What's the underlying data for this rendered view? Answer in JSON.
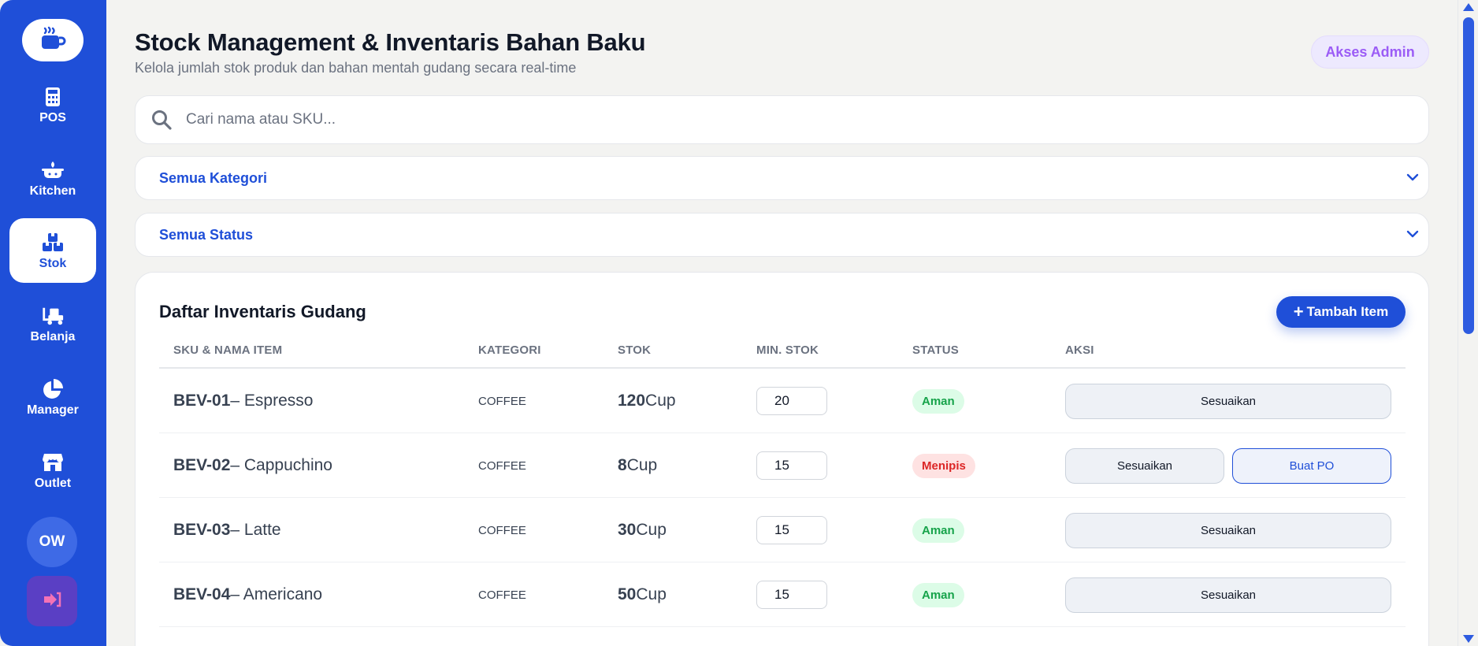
{
  "header": {
    "title": "Stock Management & Inventaris Bahan Baku",
    "subtitle": "Kelola jumlah stok produk dan bahan mentah gudang secara real-time",
    "admin_badge": "Akses Admin"
  },
  "sidebar": {
    "items": [
      {
        "label": "POS",
        "icon": "calculator-icon"
      },
      {
        "label": "Kitchen",
        "icon": "cooking-pot-icon"
      },
      {
        "label": "Stok",
        "icon": "boxes-icon"
      },
      {
        "label": "Belanja",
        "icon": "truck-icon"
      },
      {
        "label": "Manager",
        "icon": "pie-chart-icon"
      },
      {
        "label": "Outlet",
        "icon": "store-icon"
      }
    ],
    "active": "Stok",
    "avatar_initials": "OW",
    "logo_icon": "coffee-cup-icon",
    "logout_icon": "logout-icon"
  },
  "search": {
    "placeholder": "Cari nama atau SKU..."
  },
  "filters": {
    "category": "Semua Kategori",
    "status": "Semua Status"
  },
  "inventory": {
    "title": "Daftar Inventaris Gudang",
    "add_button": "Tambah Item",
    "columns": [
      "SKU & NAMA ITEM",
      "KATEGORI",
      "STOK",
      "MIN. STOK",
      "STATUS",
      "AKSI"
    ],
    "rows": [
      {
        "sku": "BEV-01",
        "name": " – Espresso",
        "category": "COFFEE",
        "stock": "120",
        "unit": " Cup",
        "min_stock": "20",
        "status": "Aman",
        "adjust": "Sesuaikan"
      },
      {
        "sku": "BEV-02",
        "name": " – Cappuchino",
        "category": "COFFEE",
        "stock": "8",
        "unit": " Cup",
        "min_stock": "15",
        "status": "Menipis",
        "adjust": "Sesuaikan",
        "po": "Buat PO"
      },
      {
        "sku": "BEV-03",
        "name": " – Latte",
        "category": "COFFEE",
        "stock": "30",
        "unit": " Cup",
        "min_stock": "15",
        "status": "Aman",
        "adjust": "Sesuaikan"
      },
      {
        "sku": "BEV-04",
        "name": " – Americano",
        "category": "COFFEE",
        "stock": "50",
        "unit": " Cup",
        "min_stock": "15",
        "status": "Aman",
        "adjust": "Sesuaikan"
      }
    ]
  },
  "colors": {
    "primary": "#1f4fd8",
    "safe": "#16a34a",
    "low": "#dc2626",
    "admin": "#9b5cf6"
  }
}
